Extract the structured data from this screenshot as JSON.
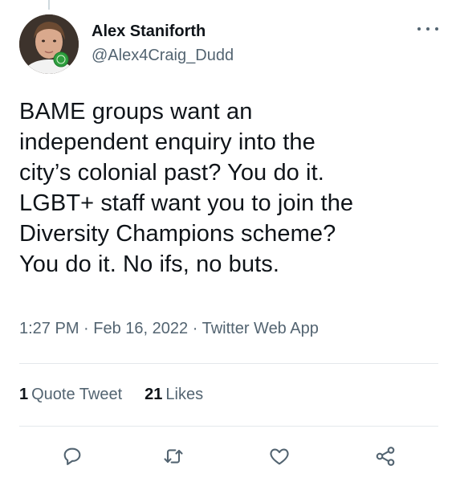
{
  "tweet": {
    "author": {
      "name": "Alex Staniforth",
      "handle": "@Alex4Craig_Dudd"
    },
    "text": "BAME groups want an\nindependent enquiry into the\ncity’s colonial past? You do it.\nLGBT+ staff want you to join the\nDiversity Champions scheme?\nYou do it. No ifs, no buts.",
    "time": "1:27 PM",
    "date": "Feb 16, 2022",
    "source": "Twitter Web App",
    "separator": "·"
  },
  "stats": {
    "quote_count": "1",
    "quote_label": "Quote Tweet",
    "likes_count": "21",
    "likes_label": "Likes"
  },
  "icons": {
    "reply": "reply-icon",
    "retweet": "retweet-icon",
    "like": "like-icon",
    "share": "share-icon",
    "more": "more-icon"
  },
  "colors": {
    "text": "#0f1419",
    "secondary": "#536471",
    "divider": "#e4e8eb",
    "icon": "#536471"
  }
}
